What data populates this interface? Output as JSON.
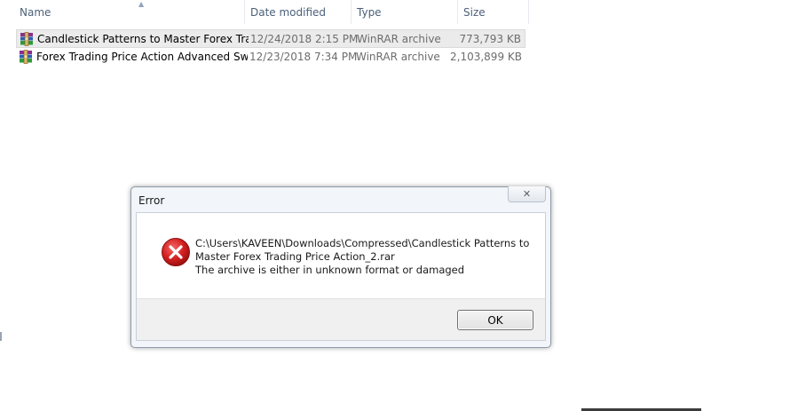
{
  "columns": {
    "name": "Name",
    "date": "Date modified",
    "type": "Type",
    "size": "Size"
  },
  "files": [
    {
      "name": "Candlestick Patterns to Master Forex Tra...",
      "date": "12/24/2018 2:15 PM",
      "type": "WinRAR archive",
      "size": "773,793 KB",
      "icon": "winrar-archive-icon"
    },
    {
      "name": "Forex Trading Price Action Advanced Swi...",
      "date": "12/23/2018 7:34 PM",
      "type": "WinRAR archive",
      "size": "2,103,899 KB",
      "icon": "winrar-archive-icon"
    }
  ],
  "dialog": {
    "title": "Error",
    "close_glyph": "✕",
    "message_line1": "C:\\Users\\KAVEEN\\Downloads\\Compressed\\Candlestick Patterns to",
    "message_line2": "Master Forex Trading Price Action_2.rar",
    "message_line3": "The archive is either in unknown format or damaged",
    "ok_label": "OK",
    "icon": "error-icon"
  },
  "colors": {
    "error_red": "#d42020",
    "selection_bg": "#ebebeb",
    "header_text": "#4c607a"
  }
}
